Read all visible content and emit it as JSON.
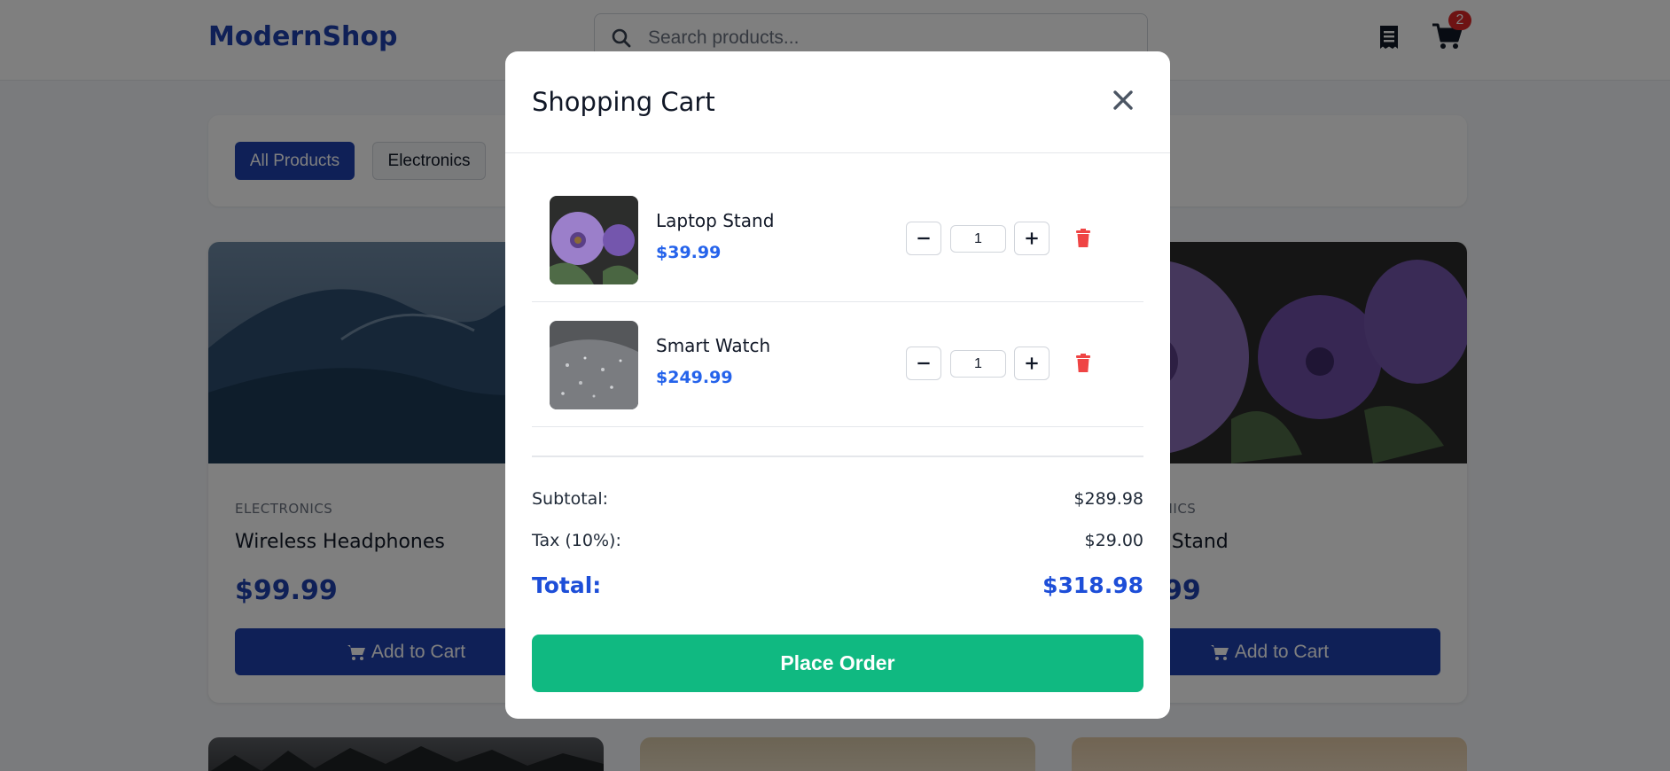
{
  "header": {
    "logo": "ModernShop",
    "search_placeholder": "Search products...",
    "cart_count": "2",
    "icons": {
      "search": "search-icon",
      "orders": "receipt-icon",
      "cart": "cart-icon"
    }
  },
  "filters": {
    "active": "All Products",
    "items": [
      "All Products",
      "Electronics"
    ]
  },
  "products": [
    {
      "category": "ELECTRONICS",
      "name": "Wireless Headphones",
      "price": "$99.99",
      "button": "Add to Cart"
    },
    {
      "category": "ELECTRONICS",
      "name": "Laptop Stand",
      "price": "$39.99",
      "button": "Add to Cart"
    }
  ],
  "cart": {
    "title": "Shopping Cart",
    "items": [
      {
        "name": "Laptop Stand",
        "price": "$39.99",
        "qty": "1"
      },
      {
        "name": "Smart Watch",
        "price": "$249.99",
        "qty": "1"
      }
    ],
    "subtotal_label": "Subtotal:",
    "subtotal": "$289.98",
    "tax_label": "Tax (10%):",
    "tax": "$29.00",
    "total_label": "Total:",
    "total": "$318.98",
    "place_order": "Place Order"
  },
  "colors": {
    "brand": "#1e40af",
    "accent_price": "#2563eb",
    "place_order": "#10b981",
    "delete": "#ef4444",
    "badge": "#dc2626"
  }
}
